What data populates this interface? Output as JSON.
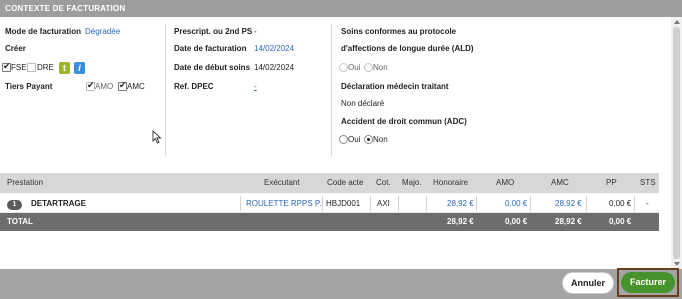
{
  "header": {
    "title": "CONTEXTE DE FACTURATION"
  },
  "col1": {
    "mode_label": "Mode de facturation",
    "mode_value": "Dégradée",
    "creer_label": "Créer",
    "fse_label": "FSE",
    "dre_label": "DRE",
    "btn_t": "t",
    "btn_i": "i",
    "tiers_label": "Tiers Payant",
    "amo_label": "AMO",
    "amc_label": "AMC"
  },
  "col2": {
    "prescript_label": "Prescript. ou 2nd PS",
    "prescript_value": "-",
    "date_fact_label": "Date de facturation",
    "date_fact_value": "14/02/2024",
    "date_debut_label": "Date de début soins",
    "date_debut_value": "14/02/2024",
    "ref_label": "Ref. DPEC",
    "ref_value": "-"
  },
  "col3": {
    "ald_label_1": "Soins conformes au protocole",
    "ald_label_2": "d'affections de longue durée (ALD)",
    "oui": "Oui",
    "non": "Non",
    "medecin_label": "Déclaration médecin traitant",
    "medecin_value": "Non déclaré",
    "adc_label": "Accident de droit commun (ADC)"
  },
  "table": {
    "headers": {
      "prestation": "Prestation",
      "executant": "Exécutant",
      "code": "Code acte",
      "cot": "Cot.",
      "majo": "Majo.",
      "honoraire": "Honoraire",
      "amo": "AMO",
      "amc": "AMC",
      "pp": "PP",
      "sts": "STS"
    },
    "row": {
      "qty": "1",
      "prestation": "DETARTRAGE",
      "executant": "ROULETTE RPPS P.",
      "code": "HBJD001",
      "cot": "AXI",
      "majo": "",
      "honoraire": "28,92 €",
      "amo": "0,00 €",
      "amc": "28,92 €",
      "pp": "0,00 €",
      "sts": "-"
    },
    "total": {
      "label": "TOTAL",
      "honoraire": "28,92 €",
      "amo": "0,00 €",
      "amc": "28,92 €",
      "pp": "0,00 €"
    }
  },
  "footer": {
    "annuler": "Annuler",
    "facturer": "Facturer"
  },
  "colors": {
    "link": "#2a6ab8",
    "facturer_bg": "#46922c",
    "header_bg": "#9d9d9d"
  }
}
